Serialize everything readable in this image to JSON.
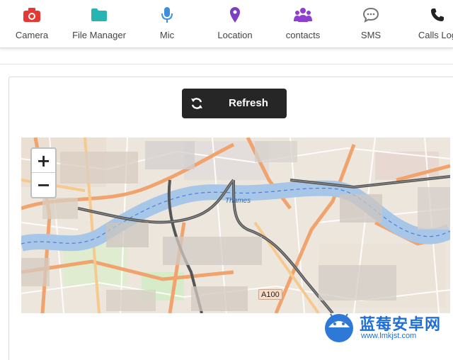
{
  "toolbar": {
    "tabs": [
      {
        "label": "Camera",
        "icon": "camera-icon",
        "color": "#e53935"
      },
      {
        "label": "File Manager",
        "icon": "folder-icon",
        "color": "#26b5b3"
      },
      {
        "label": "Mic",
        "icon": "microphone-icon",
        "color": "#3d8fdc"
      },
      {
        "label": "Location",
        "icon": "map-pin-icon",
        "color": "#7b3fc2"
      },
      {
        "label": "contacts",
        "icon": "users-icon",
        "color": "#8e3fd0"
      },
      {
        "label": "SMS",
        "icon": "chat-icon",
        "color": "#777777"
      },
      {
        "label": "Calls Log",
        "icon": "phone-icon",
        "color": "#222222"
      }
    ]
  },
  "refresh": {
    "label": "Refresh",
    "icon": "refresh-icon"
  },
  "map": {
    "zoom_in": "+",
    "zoom_out": "−",
    "road_label": "A100",
    "river_label": "Thames",
    "colors": {
      "water": "#a8c6e8",
      "land": "#ece6dc",
      "major_road": "#f1a36d",
      "motorway": "#555555"
    }
  },
  "watermark": {
    "title": "蓝莓安卓网",
    "url": "www.lmkjst.com"
  }
}
